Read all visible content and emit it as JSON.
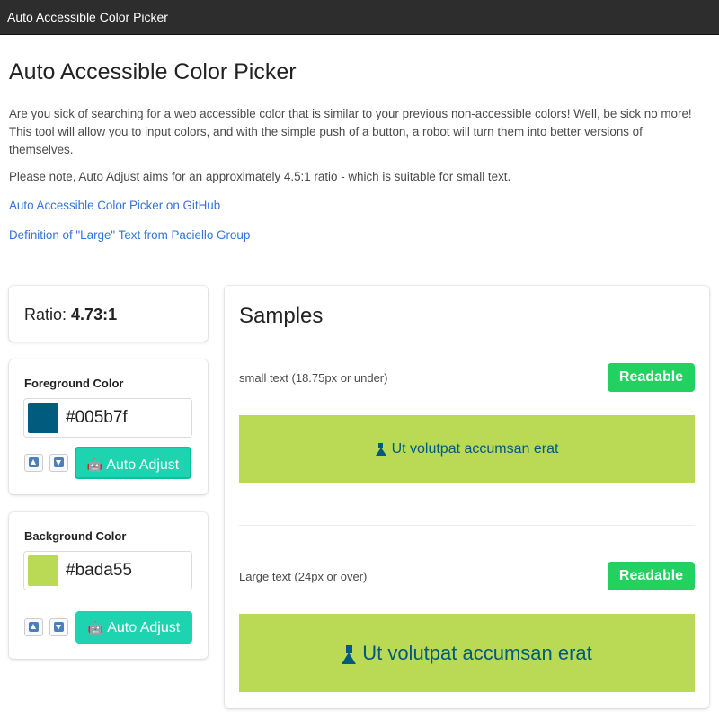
{
  "window": {
    "title": "Auto Accessible Color Picker"
  },
  "header": {
    "title": "Auto Accessible Color Picker",
    "intro": "Are you sick of searching for a web accessible color that is similar to your previous non-accessible colors! Well, be sick no more! This tool will allow you to input colors, and with the simple push of a button, a robot will turn them into better versions of themselves.",
    "note": "Please note, Auto Adjust aims for an approximately 4.5:1 ratio - which is suitable for small text.",
    "links": {
      "github": "Auto Accessible Color Picker on GitHub",
      "large_text_def": "Definition of \"Large\" Text from Paciello Group"
    }
  },
  "ratio": {
    "label": "Ratio:",
    "value": "4.73:1"
  },
  "foreground": {
    "label": "Foreground Color",
    "value": "#005b7f",
    "color": "#005b7f",
    "increase_icon": "up-arrow-icon",
    "decrease_icon": "down-arrow-icon",
    "auto_adjust_icon": "robot-icon",
    "auto_adjust_label": "Auto Adjust"
  },
  "background": {
    "label": "Background Color",
    "value": "#bada55",
    "color": "#bada55",
    "increase_icon": "up-arrow-icon",
    "decrease_icon": "down-arrow-icon",
    "auto_adjust_icon": "robot-icon",
    "auto_adjust_label": "Auto Adjust"
  },
  "samples": {
    "title": "Samples",
    "small": {
      "label": "small text (18.75px or under)",
      "status": "Readable",
      "text": "Ut volutpat accumsan erat",
      "icon": "flask-icon"
    },
    "large": {
      "label": "Large text (24px or over)",
      "status": "Readable",
      "text": "Ut volutpat accumsan erat",
      "icon": "flask-icon"
    }
  },
  "colors": {
    "accent": "#1dd3b0",
    "readable": "#23d160",
    "link": "#3273dc"
  }
}
